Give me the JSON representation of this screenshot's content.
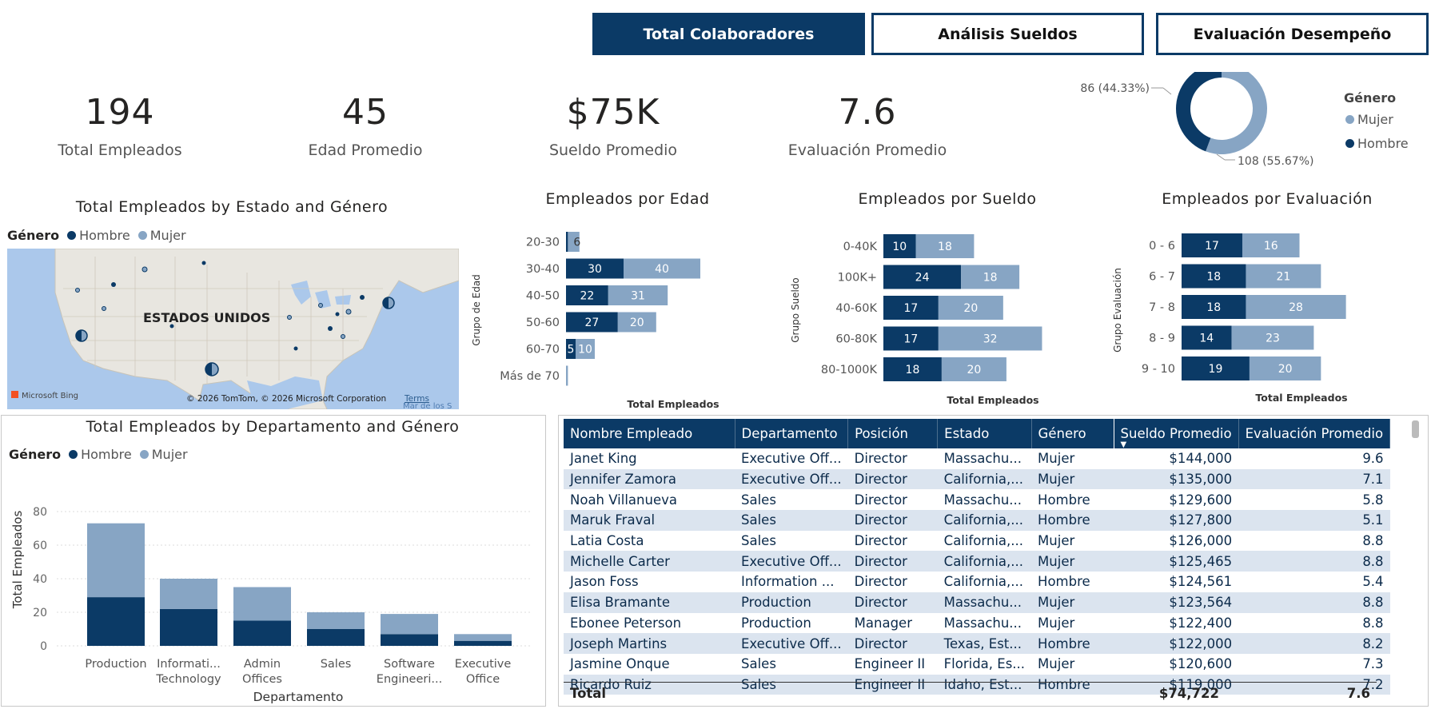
{
  "nav": {
    "buttons": [
      {
        "label": "Total Colaboradores",
        "active": true
      },
      {
        "label": "Análisis Sueldos",
        "active": false
      },
      {
        "label": "Evaluación Desempeño",
        "active": false
      }
    ]
  },
  "kpis": [
    {
      "value": "194",
      "label": "Total Empleados"
    },
    {
      "value": "45",
      "label": "Edad Promedio"
    },
    {
      "value": "$75K",
      "label": "Sueldo Promedio"
    },
    {
      "value": "7.6",
      "label": "Evaluación Promedio"
    }
  ],
  "colors": {
    "hombre": "#0b3a66",
    "mujer": "#87a5c4",
    "header": "#0b3a66",
    "stripe": "#dbe4ef"
  },
  "gender_donut": {
    "legend_title": "Género",
    "legend": [
      "Mujer",
      "Hombre"
    ],
    "label_hombre": "86 (44.33%)",
    "label_mujer": "108 (55.67%)",
    "chart_data": {
      "type": "pie",
      "categories": [
        "Mujer",
        "Hombre"
      ],
      "values": [
        108,
        86
      ]
    }
  },
  "map": {
    "title": "Total Empleados by Estado and Género",
    "legend_title": "Género",
    "legend": [
      "Hombre",
      "Mujer"
    ],
    "country_label": "ESTADOS UNIDOS",
    "bing_label": "Microsoft Bing",
    "copyright": "© 2026 TomTom, © 2026 Microsoft Corporation",
    "terms": "Terms",
    "sea_label": "Mar de los S"
  },
  "edad": {
    "title": "Empleados por Edad",
    "ylabel": "Grupo de Edad",
    "xlabel": "Total Empleados"
  },
  "sueldo": {
    "title": "Empleados por Sueldo",
    "ylabel": "Grupo Sueldo",
    "xlabel": "Total Empleados"
  },
  "evaluacion": {
    "title": "Empleados por Evaluación",
    "ylabel": "Grupo Evaluación",
    "xlabel": "Total Empleados"
  },
  "depto": {
    "title": "Total Empleados by Departamento and Género",
    "legend_title": "Género",
    "legend": [
      "Hombre",
      "Mujer"
    ],
    "ylabel": "Total Empleados",
    "xlabel": "Departamento"
  },
  "chart_data": [
    {
      "type": "bar",
      "title": "Empleados por Edad",
      "orientation": "horizontal",
      "stacked": true,
      "categories": [
        "20-30",
        "30-40",
        "40-50",
        "50-60",
        "60-70",
        "Más de 70"
      ],
      "series": [
        {
          "name": "Hombre",
          "values": [
            1,
            30,
            22,
            27,
            5,
            0
          ]
        },
        {
          "name": "Mujer",
          "values": [
            6,
            40,
            31,
            20,
            10,
            1
          ]
        }
      ],
      "data_labels": {
        "Hombre": [
          "",
          "30",
          "22",
          "27",
          "5",
          ""
        ],
        "Mujer": [
          "6",
          "40",
          "31",
          "20",
          "10",
          ""
        ]
      },
      "xlabel": "Total Empleados",
      "ylabel": "Grupo de Edad"
    },
    {
      "type": "bar",
      "title": "Empleados por Sueldo",
      "orientation": "horizontal",
      "stacked": true,
      "categories": [
        "0-40K",
        "100K+",
        "40-60K",
        "60-80K",
        "80-1000K"
      ],
      "series": [
        {
          "name": "Hombre",
          "values": [
            10,
            24,
            17,
            17,
            18
          ]
        },
        {
          "name": "Mujer",
          "values": [
            18,
            18,
            20,
            32,
            20
          ]
        }
      ],
      "xlabel": "Total Empleados",
      "ylabel": "Grupo Sueldo"
    },
    {
      "type": "bar",
      "title": "Empleados por Evaluación",
      "orientation": "horizontal",
      "stacked": true,
      "categories": [
        "0 - 6",
        "6 - 7",
        "7 - 8",
        "8 - 9",
        "9 - 10"
      ],
      "series": [
        {
          "name": "Hombre",
          "values": [
            17,
            18,
            18,
            14,
            19
          ]
        },
        {
          "name": "Mujer",
          "values": [
            16,
            21,
            28,
            23,
            20
          ]
        }
      ],
      "xlabel": "Total Empleados",
      "ylabel": "Grupo Evaluación"
    },
    {
      "type": "bar",
      "title": "Total Empleados by Departamento and Género",
      "stacked": true,
      "categories": [
        "Production",
        "Informati... Technology",
        "Admin Offices",
        "Sales",
        "Software Engineeri...",
        "Executive Office"
      ],
      "category_lines": [
        [
          "Production"
        ],
        [
          "Informati...",
          "Technology"
        ],
        [
          "Admin",
          "Offices"
        ],
        [
          "Sales"
        ],
        [
          "Software",
          "Engineeri..."
        ],
        [
          "Executive",
          "Office"
        ]
      ],
      "series": [
        {
          "name": "Hombre",
          "values": [
            29,
            22,
            15,
            10,
            7,
            3
          ]
        },
        {
          "name": "Mujer",
          "values": [
            44,
            18,
            20,
            10,
            12,
            4
          ]
        }
      ],
      "yticks": [
        "0",
        "20",
        "40",
        "60",
        "80"
      ],
      "ylim": [
        0,
        80
      ],
      "xlabel": "Departamento",
      "ylabel": "Total Empleados"
    },
    {
      "type": "pie",
      "categories": [
        "Mujer",
        "Hombre"
      ],
      "values": [
        108,
        86
      ]
    }
  ],
  "table": {
    "columns": [
      "Nombre Empleado",
      "Departamento",
      "Posición",
      "Estado",
      "Género",
      "Sueldo Promedio",
      "Evaluación Promedio"
    ],
    "sort_indicator": "▼",
    "rows": [
      [
        "Janet King",
        "Executive Off...",
        "Director",
        "Massachu...",
        "Mujer",
        "$144,000",
        "9.6"
      ],
      [
        "Jennifer Zamora",
        "Executive Off...",
        "Director",
        "California,...",
        "Mujer",
        "$135,000",
        "7.1"
      ],
      [
        "Noah Villanueva",
        "Sales",
        "Director",
        "Massachu...",
        "Hombre",
        "$129,600",
        "5.8"
      ],
      [
        "Maruk Fraval",
        "Sales",
        "Director",
        "California,...",
        "Hombre",
        "$127,800",
        "5.1"
      ],
      [
        "Latia Costa",
        "Sales",
        "Director",
        "California,...",
        "Mujer",
        "$126,000",
        "8.8"
      ],
      [
        "Michelle Carter",
        "Executive Off...",
        "Director",
        "California,...",
        "Mujer",
        "$125,465",
        "8.8"
      ],
      [
        "Jason Foss",
        "Information ...",
        "Director",
        "California,...",
        "Hombre",
        "$124,561",
        "5.4"
      ],
      [
        "Elisa Bramante",
        "Production",
        "Director",
        "Massachu...",
        "Mujer",
        "$123,564",
        "8.8"
      ],
      [
        "Ebonee Peterson",
        "Production",
        "Manager",
        "Massachu...",
        "Mujer",
        "$122,400",
        "8.8"
      ],
      [
        "Joseph Martins",
        "Executive Off...",
        "Director",
        "Texas, Est...",
        "Hombre",
        "$122,000",
        "8.2"
      ],
      [
        "Jasmine Onque",
        "Sales",
        "Engineer II",
        "Florida, Es...",
        "Mujer",
        "$120,600",
        "7.3"
      ],
      [
        "Ricardo Ruiz",
        "Sales",
        "Engineer II",
        "Idaho, Est...",
        "Hombre",
        "$119,000",
        "7.2"
      ]
    ],
    "total_label": "Total",
    "total_sueldo": "$74,722",
    "total_eval": "7.6"
  }
}
